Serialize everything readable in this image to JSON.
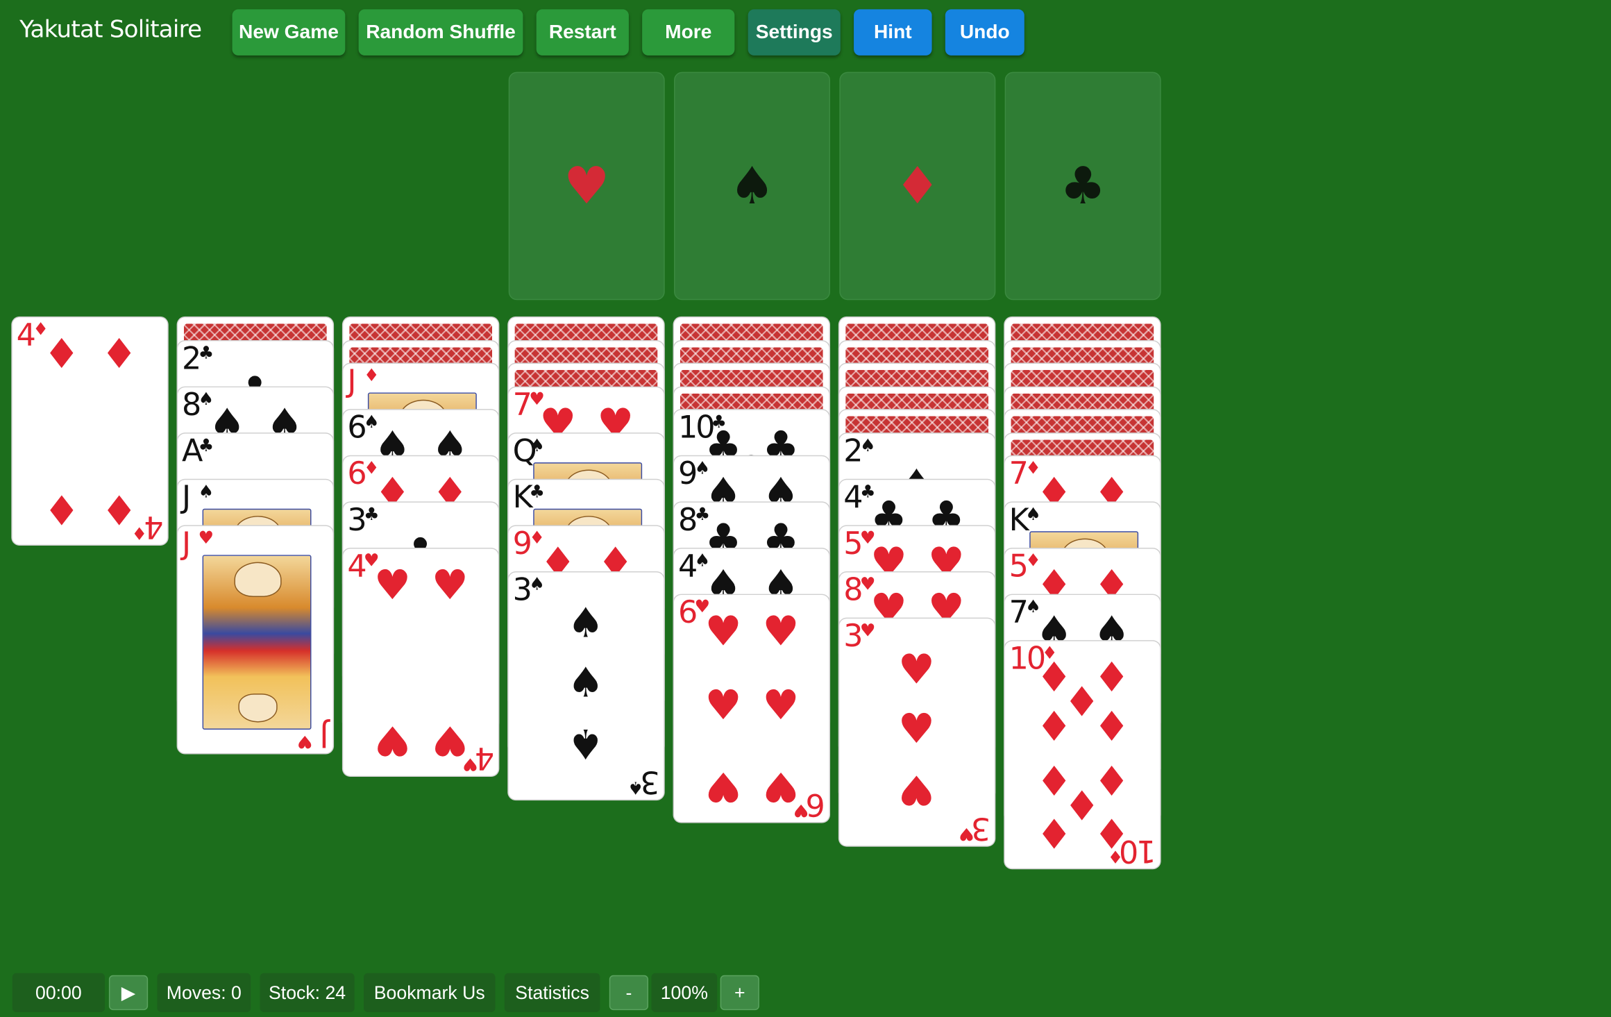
{
  "app": {
    "title": "Yakutat Solitaire"
  },
  "toolbar": {
    "new_game": "New Game",
    "random_shuffle": "Random Shuffle",
    "restart": "Restart",
    "more": "More",
    "settings": "Settings",
    "hint": "Hint",
    "undo": "Undo"
  },
  "colors": {
    "table": "#1c6e1c",
    "green_button": "#2b9a3a",
    "teal_button": "#1e7a5a",
    "blue_button": "#1584e0",
    "red_suit": "#e32330",
    "black_suit": "#111111"
  },
  "foundations": [
    {
      "suit": "♥",
      "color": "red",
      "icon": "heart-icon"
    },
    {
      "suit": "♠",
      "color": "blk",
      "icon": "spade-icon"
    },
    {
      "suit": "♦",
      "color": "red",
      "icon": "diamond-icon"
    },
    {
      "suit": "♣",
      "color": "blk",
      "icon": "club-icon"
    }
  ],
  "tableau": [
    {
      "facedown": 0,
      "cards": [
        {
          "rank": "4",
          "suit": "♦"
        }
      ]
    },
    {
      "facedown": 1,
      "cards": [
        {
          "rank": "2",
          "suit": "♣"
        },
        {
          "rank": "8",
          "suit": "♠"
        },
        {
          "rank": "A",
          "suit": "♣"
        },
        {
          "rank": "J",
          "suit": "♠"
        },
        {
          "rank": "J",
          "suit": "♥"
        }
      ]
    },
    {
      "facedown": 2,
      "cards": [
        {
          "rank": "J",
          "suit": "♦"
        },
        {
          "rank": "6",
          "suit": "♠"
        },
        {
          "rank": "6",
          "suit": "♦"
        },
        {
          "rank": "3",
          "suit": "♣"
        },
        {
          "rank": "4",
          "suit": "♥"
        }
      ]
    },
    {
      "facedown": 3,
      "cards": [
        {
          "rank": "7",
          "suit": "♥"
        },
        {
          "rank": "Q",
          "suit": "♠"
        },
        {
          "rank": "K",
          "suit": "♣"
        },
        {
          "rank": "9",
          "suit": "♦"
        },
        {
          "rank": "3",
          "suit": "♠"
        }
      ]
    },
    {
      "facedown": 4,
      "cards": [
        {
          "rank": "10",
          "suit": "♣"
        },
        {
          "rank": "9",
          "suit": "♠"
        },
        {
          "rank": "8",
          "suit": "♣"
        },
        {
          "rank": "4",
          "suit": "♠"
        },
        {
          "rank": "6",
          "suit": "♥"
        }
      ]
    },
    {
      "facedown": 5,
      "cards": [
        {
          "rank": "2",
          "suit": "♠"
        },
        {
          "rank": "4",
          "suit": "♣"
        },
        {
          "rank": "5",
          "suit": "♥"
        },
        {
          "rank": "8",
          "suit": "♥"
        },
        {
          "rank": "3",
          "suit": "♥"
        }
      ]
    },
    {
      "facedown": 6,
      "cards": [
        {
          "rank": "7",
          "suit": "♦"
        },
        {
          "rank": "K",
          "suit": "♠"
        },
        {
          "rank": "5",
          "suit": "♦"
        },
        {
          "rank": "7",
          "suit": "♠"
        },
        {
          "rank": "10",
          "suit": "♦"
        }
      ]
    }
  ],
  "statusbar": {
    "time": "00:00",
    "play": "▶",
    "moves": "Moves: 0",
    "stock": "Stock: 24",
    "bookmark": "Bookmark Us",
    "statistics": "Statistics",
    "zoom_out": "-",
    "zoom": "100%",
    "zoom_in": "+"
  }
}
